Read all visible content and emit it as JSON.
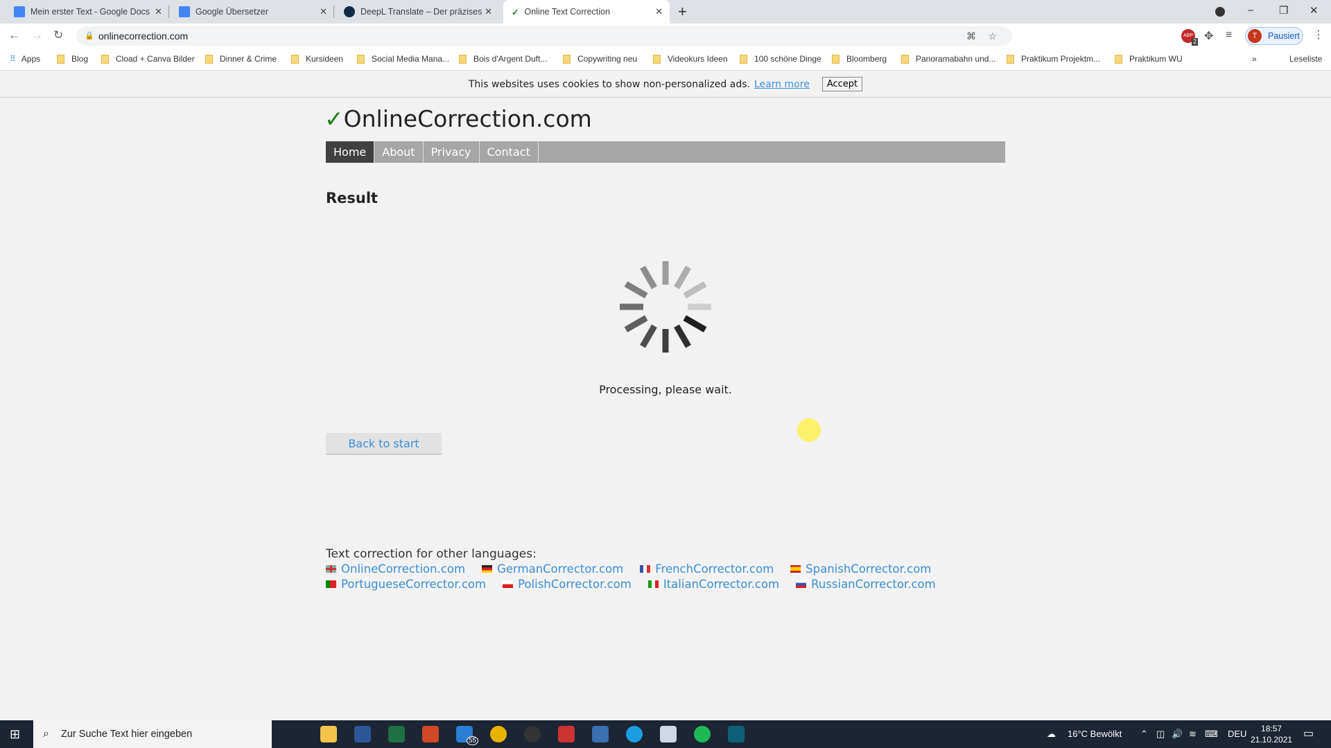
{
  "browser": {
    "tabs": [
      {
        "title": "Mein erster Text - Google Docs",
        "icon": "google-docs-icon",
        "color": "#4285f4"
      },
      {
        "title": "Google Übersetzer",
        "icon": "google-translate-icon",
        "color": "#4285f4"
      },
      {
        "title": "DeepL Translate – Der präziseste",
        "icon": "deepl-icon",
        "color": "#0f2b46"
      },
      {
        "title": "Online Text Correction",
        "icon": "checkmark-icon",
        "color": "#1a7f1a",
        "active": true
      }
    ],
    "url": "onlinecorrection.com",
    "profile_label": "Pausiert",
    "profile_initial": "T",
    "abp_badge": "2",
    "bookmarks": [
      "Apps",
      "Blog",
      "Cload + Canva Bilder",
      "Dinner & Crime",
      "Kursideen",
      "Social Media Mana...",
      "Bois d'Argent Duft...",
      "Copywriting neu",
      "Videokurs Ideen",
      "100 schöne Dinge",
      "Bloomberg",
      "Panoramabahn und...",
      "Praktikum Projektm...",
      "Praktikum WU"
    ],
    "reading_list": "Leseliste",
    "more": "»"
  },
  "cookie": {
    "text": "This websites uses cookies to show non-personalized ads.",
    "learn_more": "Learn more",
    "accept": "Accept"
  },
  "site": {
    "logo_check": "✓",
    "logo_text": "OnlineCorrection.com",
    "nav": [
      "Home",
      "About",
      "Privacy",
      "Contact"
    ],
    "active_nav": "Home",
    "heading": "Result",
    "processing": "Processing, please wait.",
    "back": "Back to start",
    "footer_title": "Text correction for other languages:",
    "links_row1": [
      {
        "label": "OnlineCorrection.com",
        "flag": "uk"
      },
      {
        "label": "GermanCorrector.com",
        "flag": "de"
      },
      {
        "label": "FrenchCorrector.com",
        "flag": "fr"
      },
      {
        "label": "SpanishCorrector.com",
        "flag": "es"
      }
    ],
    "links_row2": [
      {
        "label": "PortugueseCorrector.com",
        "flag": "pt"
      },
      {
        "label": "PolishCorrector.com",
        "flag": "pl"
      },
      {
        "label": "ItalianCorrector.com",
        "flag": "it"
      },
      {
        "label": "RussianCorrector.com",
        "flag": "ru"
      }
    ],
    "link_color": "#3b8ed6"
  },
  "taskbar": {
    "search_placeholder": "Zur Suche Text hier eingeben",
    "mail_badge": "55",
    "weather": "16°C  Bewölkt",
    "lang": "DEU",
    "time": "18:57",
    "date": "21.10.2021"
  }
}
